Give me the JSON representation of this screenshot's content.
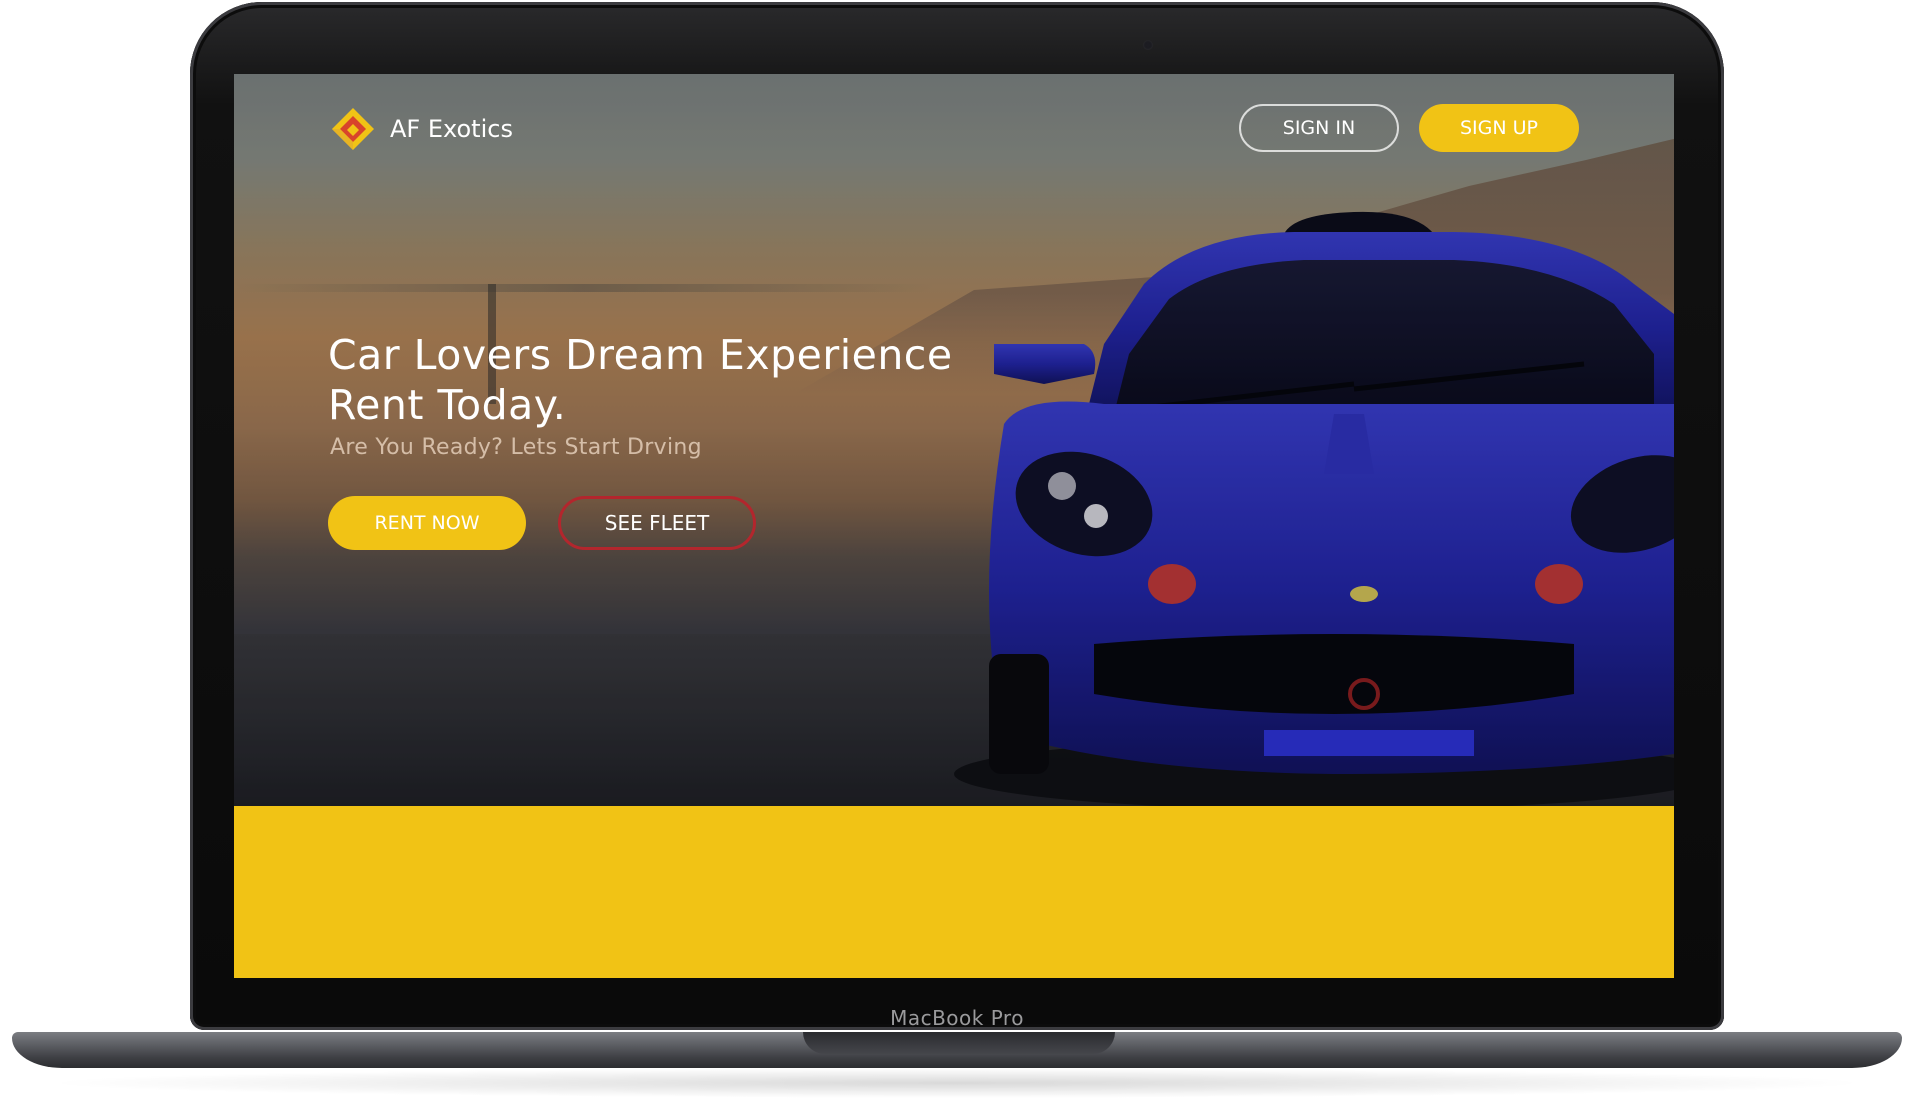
{
  "device": {
    "label": "MacBook Pro"
  },
  "header": {
    "brand_name": "AF Exotics",
    "sign_in_label": "SIGN IN",
    "sign_up_label": "SIGN UP"
  },
  "hero": {
    "headline_line1": "Car Lovers Dream Experience",
    "headline_line2": "Rent Today.",
    "subheadline": "Are You Ready? Lets Start Drving",
    "rent_now_label": "RENT NOW",
    "see_fleet_label": "SEE FLEET"
  },
  "colors": {
    "accent_yellow": "#f1c315",
    "accent_red": "#b3262d",
    "car_blue": "#2326a8"
  },
  "icons": {
    "logo": "diamond-logo-icon"
  }
}
